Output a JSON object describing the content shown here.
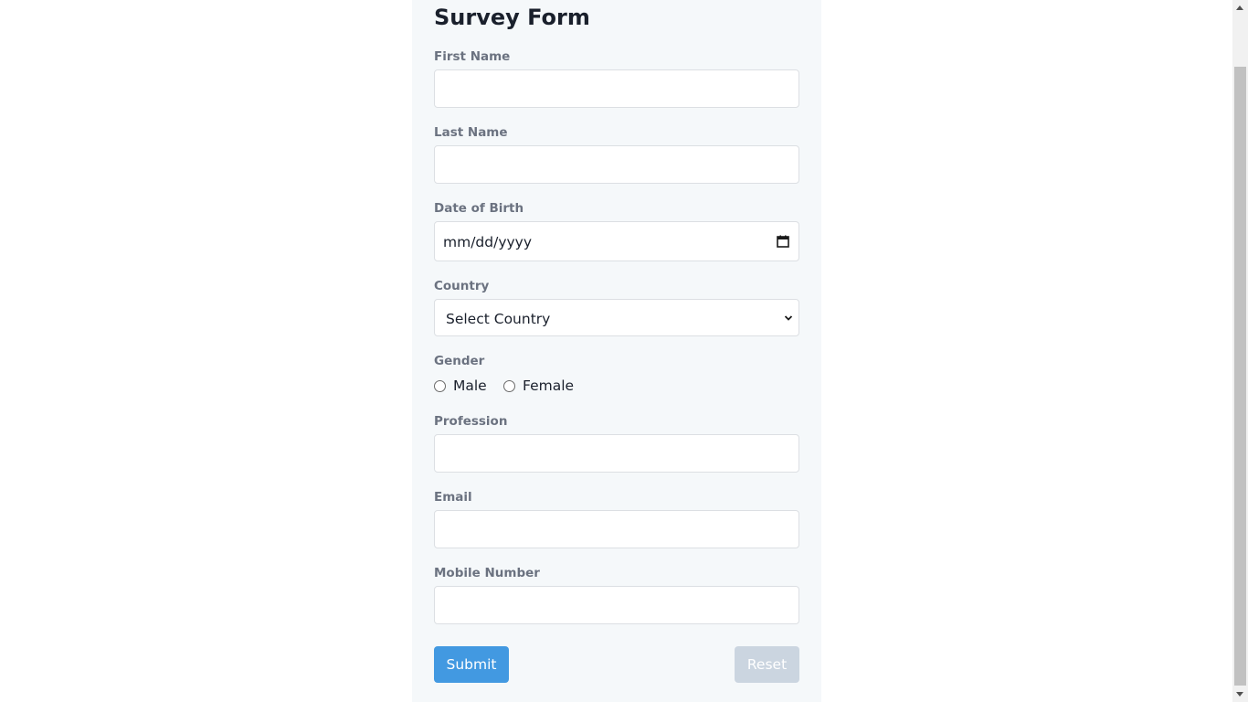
{
  "form": {
    "title": "Survey Form",
    "first_name_label": "First Name",
    "first_name_value": "",
    "last_name_label": "Last Name",
    "last_name_value": "",
    "dob_label": "Date of Birth",
    "dob_placeholder": "mm/dd/yyyy",
    "country_label": "Country",
    "country_selected": "Select Country",
    "gender_label": "Gender",
    "gender_options": [
      "Male",
      "Female"
    ],
    "profession_label": "Profession",
    "profession_value": "",
    "email_label": "Email",
    "email_value": "",
    "mobile_label": "Mobile Number",
    "mobile_value": "",
    "submit_label": "Submit",
    "reset_label": "Reset"
  },
  "icons": {
    "date_picker": "calendar-icon",
    "select": "chevron-down-icon"
  },
  "colors": {
    "panel_bg": "#f5f8fa",
    "submit_bg": "#4299e1",
    "reset_bg": "#cbd5e0",
    "label_text": "#6b7280"
  }
}
